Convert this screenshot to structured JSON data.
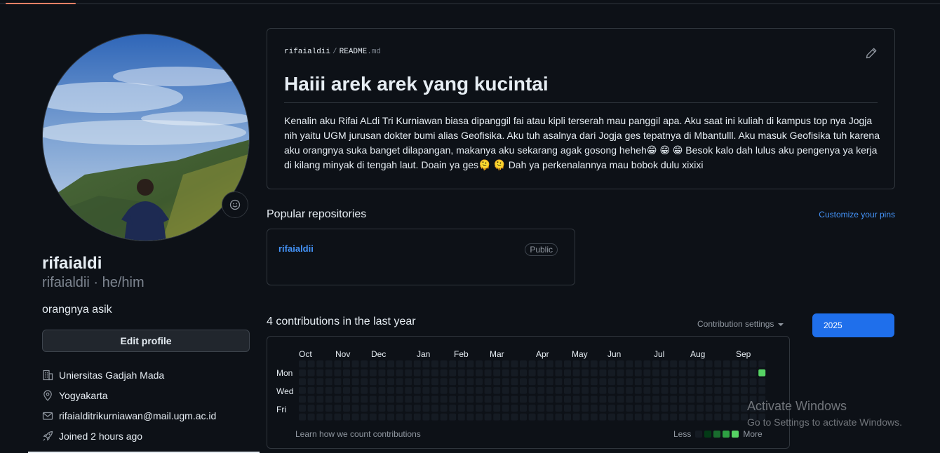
{
  "profile": {
    "name": "rifaialdi",
    "username_pronouns": "rifaialdii · he/him",
    "bio": "orangnya asik",
    "edit_label": "Edit profile",
    "details": [
      {
        "icon": "building-icon",
        "text": "Uniersitas Gadjah Mada"
      },
      {
        "icon": "location-icon",
        "text": "Yogyakarta"
      },
      {
        "icon": "mail-icon",
        "text": "rifaialditrikurniawan@mail.ugm.ac.id"
      },
      {
        "icon": "rocket-icon",
        "text": "Joined 2 hours ago"
      }
    ]
  },
  "readme": {
    "owner": "rifaialdii",
    "separator": "/",
    "file": "README",
    "ext": ".md",
    "heading": "Haiii arek arek yang kucintai",
    "body": "Kenalin aku Rifai ALdi Tri Kurniawan biasa dipanggil fai atau kipli terserah mau panggil apa. Aku saat ini kuliah di kampus top nya Jogja nih yaitu UGM jurusan dokter bumi alias Geofisika. Aku tuh asalnya dari Jogja ges tepatnya di Mbantulll. Aku masuk Geofisika tuh karena aku orangnya suka banget dilapangan, makanya aku sekarang agak gosong heheh😁 😁 😁 Besok kalo dah lulus aku pengenya ya kerja di kilang minyak di tengah laut. Doain ya ges🫠 🫠 Dah ya perkenalannya mau bobok dulu xixixi"
  },
  "popular": {
    "title": "Popular repositories",
    "customize": "Customize your pins",
    "repos": [
      {
        "name": "rifaialdii",
        "visibility": "Public"
      }
    ]
  },
  "contributions": {
    "title": "4 contributions in the last year",
    "settings": "Contribution settings",
    "year": "2025",
    "months": [
      "Oct",
      "Nov",
      "Dec",
      "Jan",
      "Feb",
      "Mar",
      "Apr",
      "May",
      "Jun",
      "Jul",
      "Aug",
      "Sep"
    ],
    "days": [
      "Mon",
      "Wed",
      "Fri"
    ],
    "learn": "Learn how we count contributions",
    "less": "Less",
    "more": "More",
    "weeks": 53,
    "active_cell": {
      "week": 52,
      "day": 1,
      "level": 4
    },
    "colors": {
      "empty": "#151b23",
      "levels": [
        "#151b23",
        "#033a16",
        "#196c2e",
        "#2ea043",
        "#56d364"
      ]
    }
  },
  "watermark": {
    "title": "Activate Windows",
    "subtitle": "Go to Settings to activate Windows."
  }
}
